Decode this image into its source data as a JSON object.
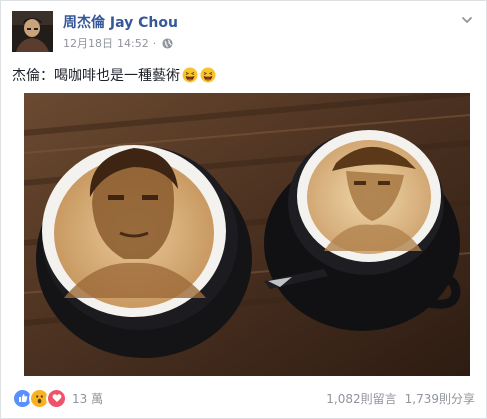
{
  "post": {
    "author": "周杰倫 Jay Chou",
    "date": "12月18日",
    "time": "14:52",
    "separator": "·",
    "text": "杰倫：喝咖啡也是一種藝術",
    "emoji": [
      "laughing-face",
      "laughing-face"
    ]
  },
  "reactions": {
    "types": [
      "like",
      "wow",
      "love"
    ],
    "colors": {
      "like": "#5890ff",
      "wow": "#f7b125",
      "love": "#f25268"
    },
    "count": "13 萬"
  },
  "stats": {
    "comments": "1,082則留言",
    "shares": "1,739則分享"
  },
  "icons": {
    "privacy": "globe-icon",
    "menu": "chevron-down-icon"
  }
}
